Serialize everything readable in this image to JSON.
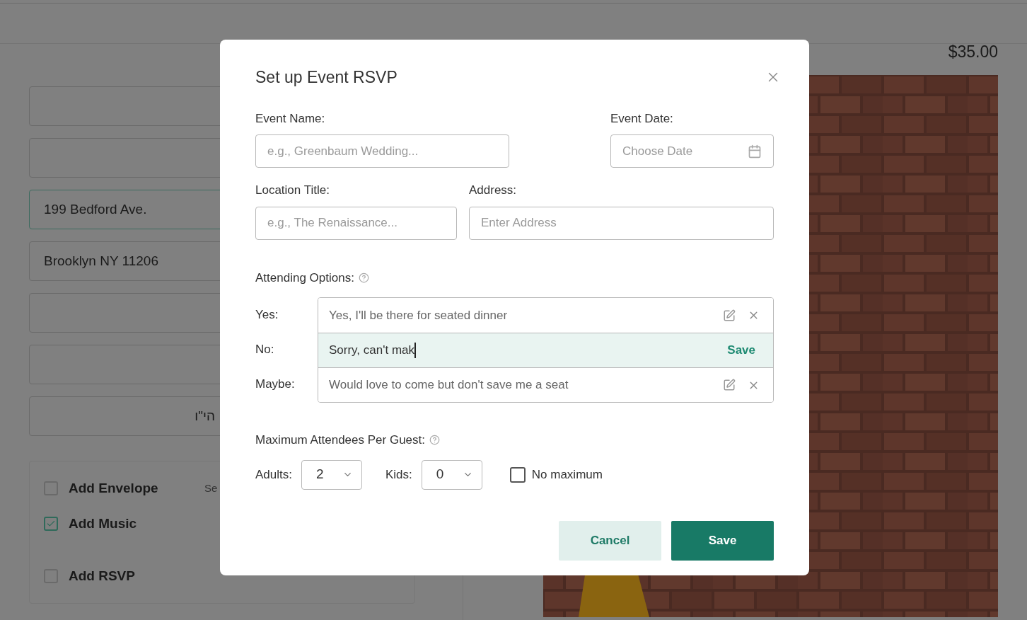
{
  "background": {
    "fields": [
      {
        "kind": "empty",
        "focused": false
      },
      {
        "kind": "empty",
        "focused": false
      },
      {
        "kind": "text",
        "value": "199 Bedford Ave.",
        "focused": true
      },
      {
        "kind": "text",
        "value": "Brooklyn NY 11206",
        "focused": false
      },
      {
        "kind": "empty",
        "focused": false
      },
      {
        "kind": "empty",
        "focused": false
      },
      {
        "kind": "rtl",
        "value": "הי\"ו",
        "focused": false
      }
    ],
    "addons": [
      {
        "label": "Add Envelope",
        "checked": false,
        "note": "Se"
      },
      {
        "label": "Add Music",
        "checked": true
      },
      {
        "label": "Add RSVP",
        "checked": false
      }
    ],
    "price": "$35.00"
  },
  "modal": {
    "title": "Set up Event RSVP",
    "event_name": {
      "label": "Event Name:",
      "placeholder": "e.g., Greenbaum Wedding..."
    },
    "event_date": {
      "label": "Event Date:",
      "placeholder": "Choose Date"
    },
    "location_title": {
      "label": "Location Title:",
      "placeholder": "e.g., The Renaissance..."
    },
    "address": {
      "label": "Address:",
      "placeholder": "Enter Address"
    },
    "attending": {
      "label": "Attending Options:",
      "options": [
        {
          "label": "Yes:",
          "value": "Yes, I'll be there for seated dinner",
          "editing": false
        },
        {
          "label": "No:",
          "value": "Sorry, can't mak",
          "editing": true,
          "action": "Save"
        },
        {
          "label": "Maybe:",
          "value": "Would love to come but don't save me a seat",
          "editing": false
        }
      ]
    },
    "max_attendees": {
      "label": "Maximum Attendees Per Guest:",
      "adults": {
        "label": "Adults:",
        "value": "2"
      },
      "kids": {
        "label": "Kids:",
        "value": "0"
      },
      "no_maximum": {
        "label": "No maximum",
        "checked": false
      }
    },
    "buttons": {
      "cancel": "Cancel",
      "save": "Save"
    }
  }
}
